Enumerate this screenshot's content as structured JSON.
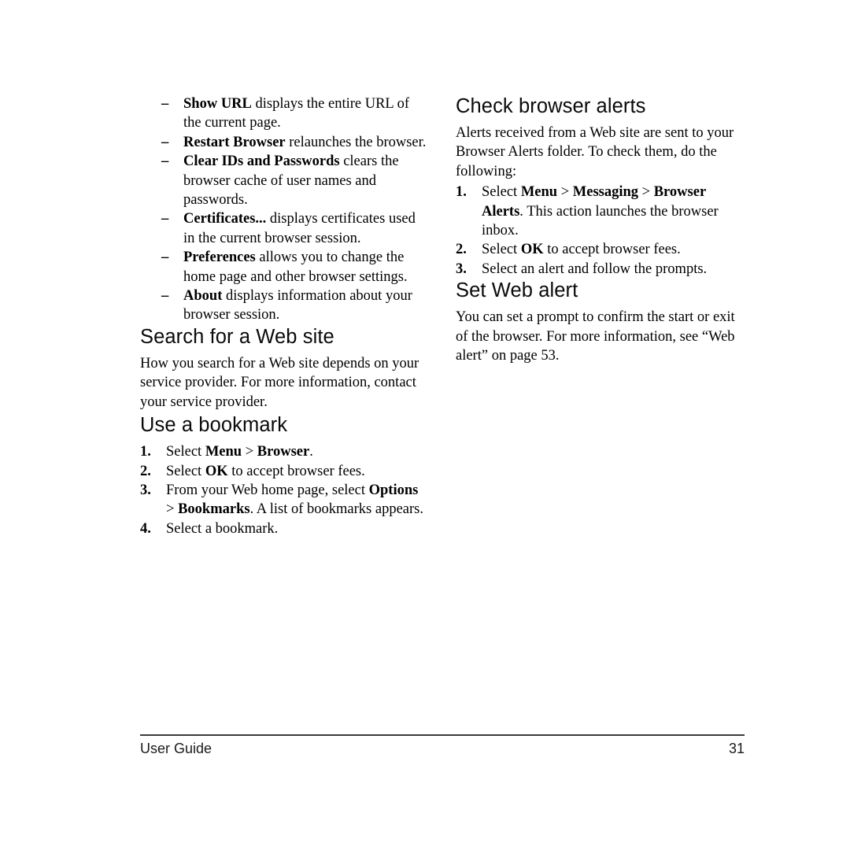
{
  "document": {
    "page_number": "31",
    "footer_label": "User Guide"
  },
  "left_column": {
    "bullet_list": {
      "marker": "–",
      "items": [
        {
          "term": "Show URL",
          "description": " displays the entire URL of the current page."
        },
        {
          "term": "Restart Browser",
          "description": " relaunches the browser."
        },
        {
          "term": "Clear IDs and Passwords",
          "description": " clears the browser cache of user names and passwords."
        },
        {
          "term": "Certificates...",
          "description": " displays certificates used in the current browser session."
        },
        {
          "term": "Preferences",
          "description": " allows you to change the home page and other browser settings."
        },
        {
          "term": "About",
          "description": " displays information about your browser session."
        }
      ]
    },
    "search_section": {
      "heading": "Search for a Web site",
      "paragraph": "How you search for a Web site depends on your service provider. For more information, contact your service provider."
    },
    "bookmark_section": {
      "heading": "Use a bookmark",
      "steps": [
        {
          "number": "1.",
          "pre": "Select ",
          "bold": "Menu",
          "mid": " > ",
          "bold2": "Browser",
          "post": "."
        },
        {
          "number": "2.",
          "pre": "Select ",
          "bold": "OK",
          "mid": "",
          "bold2": "",
          "post": " to accept browser fees."
        },
        {
          "number": "3.",
          "pre": "From your Web home page, select ",
          "bold": "Options",
          "mid": " > ",
          "bold2": "Bookmarks",
          "post": ". A list of bookmarks appears."
        },
        {
          "number": "4.",
          "pre": "Select a bookmark.",
          "bold": "",
          "mid": "",
          "bold2": "",
          "post": ""
        }
      ]
    }
  },
  "right_column": {
    "alerts_section": {
      "heading": "Check browser alerts",
      "paragraph": "Alerts received from a Web site are sent to your Browser Alerts folder. To check them, do the following:",
      "steps": [
        {
          "number": "1.",
          "pre": "Select ",
          "bold": "Menu",
          "mid": " > ",
          "bold2": "Messaging",
          "mid2": " > ",
          "bold3": "Browser Alerts",
          "post": ". This action launches the browser inbox."
        },
        {
          "number": "2.",
          "pre": "Select ",
          "bold": "OK",
          "mid": "",
          "bold2": "",
          "mid2": "",
          "bold3": "",
          "post": " to accept browser fees."
        },
        {
          "number": "3.",
          "pre": "Select an alert and follow the prompts.",
          "bold": "",
          "mid": "",
          "bold2": "",
          "mid2": "",
          "bold3": "",
          "post": ""
        }
      ]
    },
    "web_alert_section": {
      "heading": "Set Web alert",
      "paragraph": "You can set a prompt to confirm the start or exit of the browser. For more information, see “Web alert” on page 53."
    }
  }
}
